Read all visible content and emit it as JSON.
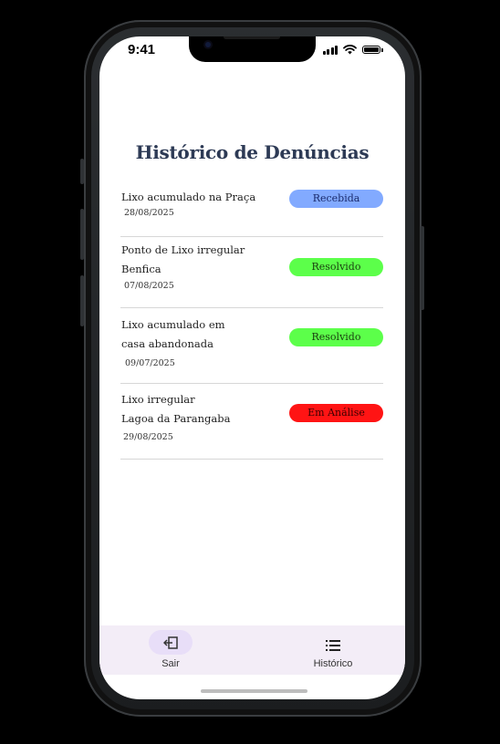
{
  "status_bar": {
    "time": "9:41"
  },
  "page": {
    "title": "Histórico de Denúncias"
  },
  "reports": [
    {
      "title_lines": [
        "Lixo acumulado na Praça"
      ],
      "date": "28/08/2025",
      "status": "Recebida",
      "status_bg": "#82aaff",
      "status_color": "#1a2a6b"
    },
    {
      "title_lines": [
        "Ponto de Lixo irregular",
        "Benfica"
      ],
      "date": "07/08/2025",
      "status": "Resolvido",
      "status_bg": "#5cff4a",
      "status_color": "#1a3d10"
    },
    {
      "title_lines": [
        "Lixo acumulado em",
        "casa abandonada"
      ],
      "date": "09/07/2025",
      "status": "Resolvido",
      "status_bg": "#5cff4a",
      "status_color": "#1a3d10"
    },
    {
      "title_lines": [
        "Lixo irregular",
        "Lagoa da Parangaba"
      ],
      "date": "29/08/2025",
      "status": "Em Análise",
      "status_bg": "#ff1414",
      "status_color": "#3a0000"
    }
  ],
  "bottom_nav": {
    "items": [
      {
        "label": "Sair",
        "icon": "logout-icon",
        "active": true
      },
      {
        "label": "Histórico",
        "icon": "list-icon",
        "active": false
      }
    ]
  },
  "colors": {
    "title": "#2d3a55",
    "nav_bg": "#f3edf7",
    "nav_active_pill": "#e8def8"
  }
}
